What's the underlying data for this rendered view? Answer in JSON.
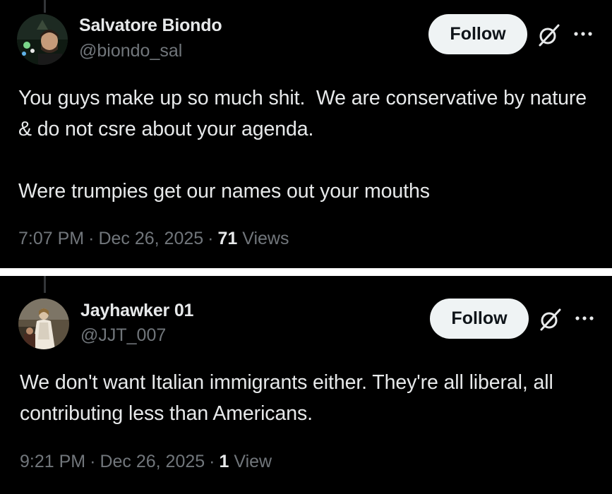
{
  "tweets": [
    {
      "display_name": "Salvatore Biondo",
      "handle": "@biondo_sal",
      "follow_label": "Follow",
      "text": "You guys make up so much shit.  We are conservative by nature & do not csre about your agenda.\n\nWere trumpies get our names out your mouths",
      "time": "7:07 PM",
      "separator": "·",
      "date": "Dec 26, 2025",
      "views_count": "71",
      "views_label": "Views",
      "avatar_icon": "profile-photo"
    },
    {
      "display_name": "Jayhawker 01",
      "handle": "@JJT_007",
      "follow_label": "Follow",
      "text": "We don't want Italian immigrants either. They're all liberal, all contributing less than Americans.",
      "time": "9:21 PM",
      "separator": "·",
      "date": "Dec 26, 2025",
      "views_count": "1",
      "views_label": "View",
      "avatar_icon": "painting-portrait"
    }
  ],
  "icons": {
    "grok": "grok-icon",
    "more": "more-icon"
  },
  "colors": {
    "background": "#000000",
    "primary_text": "#e7e9ea",
    "secondary_text": "#71767b",
    "follow_button_bg": "#eff3f4",
    "follow_button_text": "#0f1419",
    "separator": "#ffffff"
  }
}
